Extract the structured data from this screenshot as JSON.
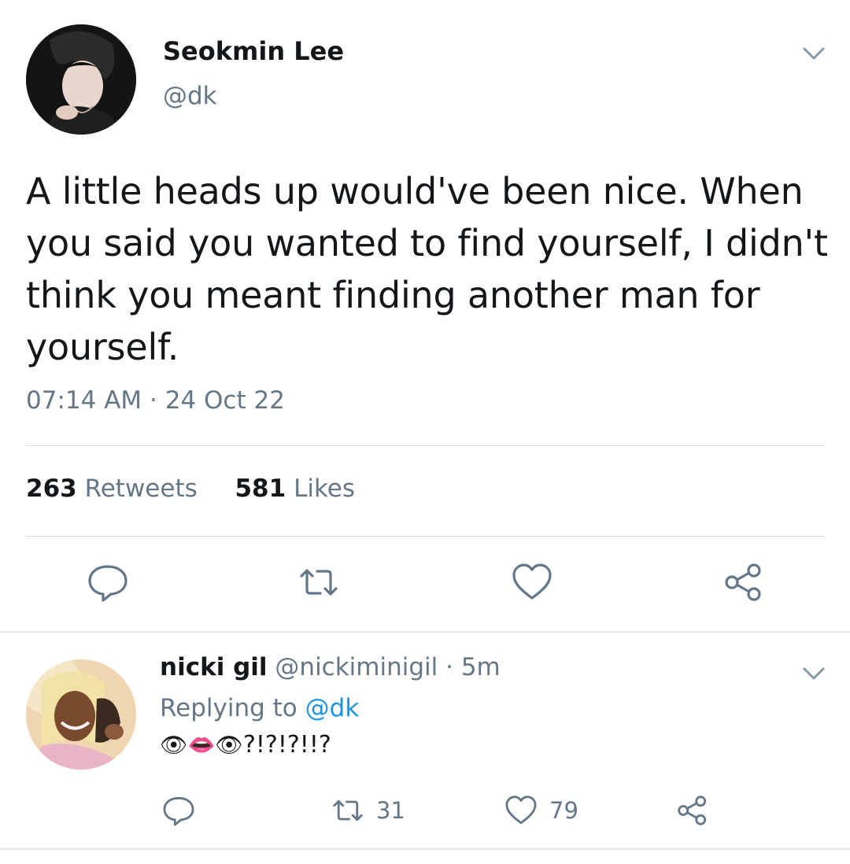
{
  "tweet": {
    "author": {
      "name": "Seokmin Lee",
      "handle": "@dk"
    },
    "text": "A little heads up would've been nice. When you said you wanted to find yourself, I didn't think you meant finding another man for yourself.",
    "time": "07:14 AM",
    "date": "24 Oct 22",
    "stats": {
      "retweets_count": "263",
      "retweets_label": "Retweets",
      "likes_count": "581",
      "likes_label": "Likes"
    },
    "actions": [
      "reply-icon",
      "retweet-icon",
      "heart-icon",
      "share-icon"
    ]
  },
  "reply": {
    "author": {
      "name": "nicki gil",
      "handle": "@nickiminigil",
      "age": "5m"
    },
    "replying_prefix": "Replying to",
    "replying_to": "@dk",
    "emojis": "👁👄👁",
    "text": "?!?!?!!?",
    "retweet_count": "31",
    "like_count": "79",
    "actions": [
      "reply-icon",
      "retweet-icon",
      "heart-icon",
      "share-icon"
    ]
  },
  "colors": {
    "text": "#14171a",
    "secondary": "#657786",
    "link": "#1b95e0",
    "divider": "#d7dee3"
  }
}
